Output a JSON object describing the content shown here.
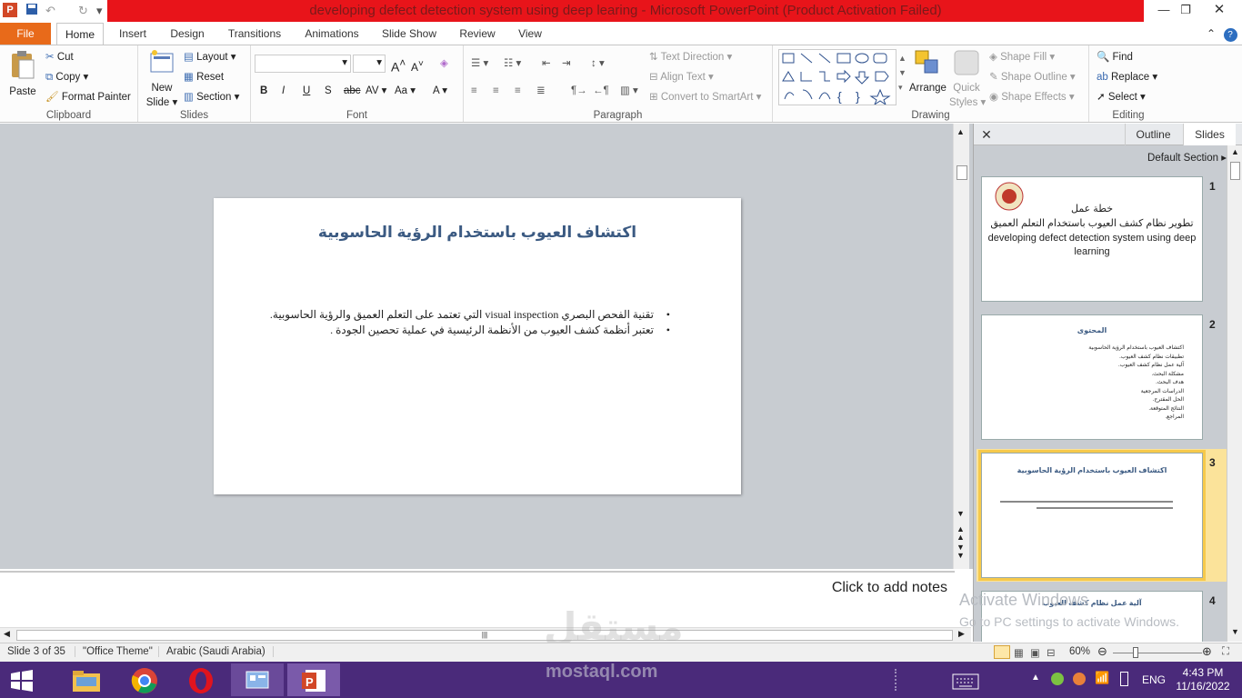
{
  "window": {
    "title": "developing defect detection system using deep learing  -  Microsoft PowerPoint (Product Activation Failed)"
  },
  "tabs": [
    "File",
    "Home",
    "Insert",
    "Design",
    "Transitions",
    "Animations",
    "Slide Show",
    "Review",
    "View"
  ],
  "ribbon": {
    "clipboard": {
      "label": "Clipboard",
      "paste": "Paste",
      "cut": "Cut",
      "copy": "Copy",
      "format_painter": "Format Painter"
    },
    "slides": {
      "label": "Slides",
      "new_slide_1": "New",
      "new_slide_2": "Slide",
      "layout": "Layout",
      "reset": "Reset",
      "section": "Section"
    },
    "font": {
      "label": "Font"
    },
    "paragraph": {
      "label": "Paragraph",
      "text_direction": "Text Direction",
      "align_text": "Align Text",
      "convert": "Convert to SmartArt"
    },
    "drawing": {
      "label": "Drawing",
      "arrange": "Arrange",
      "quick_styles_1": "Quick",
      "quick_styles_2": "Styles",
      "shape_fill": "Shape Fill",
      "shape_outline": "Shape Outline",
      "shape_effects": "Shape Effects"
    },
    "editing": {
      "label": "Editing",
      "find": "Find",
      "replace": "Replace",
      "select": "Select"
    }
  },
  "slide": {
    "title": "اكتشاف العيوب باستخدام الرؤية الحاسوبية",
    "bullets": [
      "تقنية الفحص البصري  visual inspection  التي تعتمد على التعلم العميق والرؤية الحاسوبية.",
      "تعتبر أنظمة كشف العيوب من الأنظمة الرئيسية في عملية تحصين الجودة ."
    ]
  },
  "notes": {
    "placeholder": "Click to add notes"
  },
  "pane": {
    "tab_outline": "Outline",
    "tab_slides": "Slides",
    "section": "Default Section",
    "thumbs": [
      {
        "num": "1",
        "line1": "خطة عمل",
        "line2": "تطوير نظام كشف العيوب باستخدام التعلم العميق",
        "line3": "developing defect detection system using deep learning"
      },
      {
        "num": "2",
        "title": "المحتوى",
        "items": [
          "اكتشاف العيوب باستخدام الرؤية الحاسوبية",
          "تطبيقات نظام كشف العيوب.",
          "آلية عمل نظام كشف العيوب.",
          "مشكلة البحث.",
          "هدف البحث.",
          "الدراسات المرجعية",
          "الحل المقترح.",
          "النتائج المتوقعة.",
          "المراجع."
        ]
      },
      {
        "num": "3",
        "title": "اكتشاف العيوب باستخدام الرؤية الحاسوبية"
      },
      {
        "num": "4",
        "title": "آلية عمل نظام كشف العيوب"
      }
    ]
  },
  "status": {
    "slide": "Slide 3 of 35",
    "theme": "\"Office Theme\"",
    "lang": "Arabic (Saudi Arabia)",
    "zoom": "60%"
  },
  "activation": {
    "line1": "Activate Windows",
    "line2": "Go to PC settings to activate Windows."
  },
  "watermark": {
    "ar": "مستقل",
    "en": "mostaql.com"
  },
  "taskbar": {
    "lang": "ENG",
    "time": "4:43 PM",
    "date": "11/16/2022"
  }
}
